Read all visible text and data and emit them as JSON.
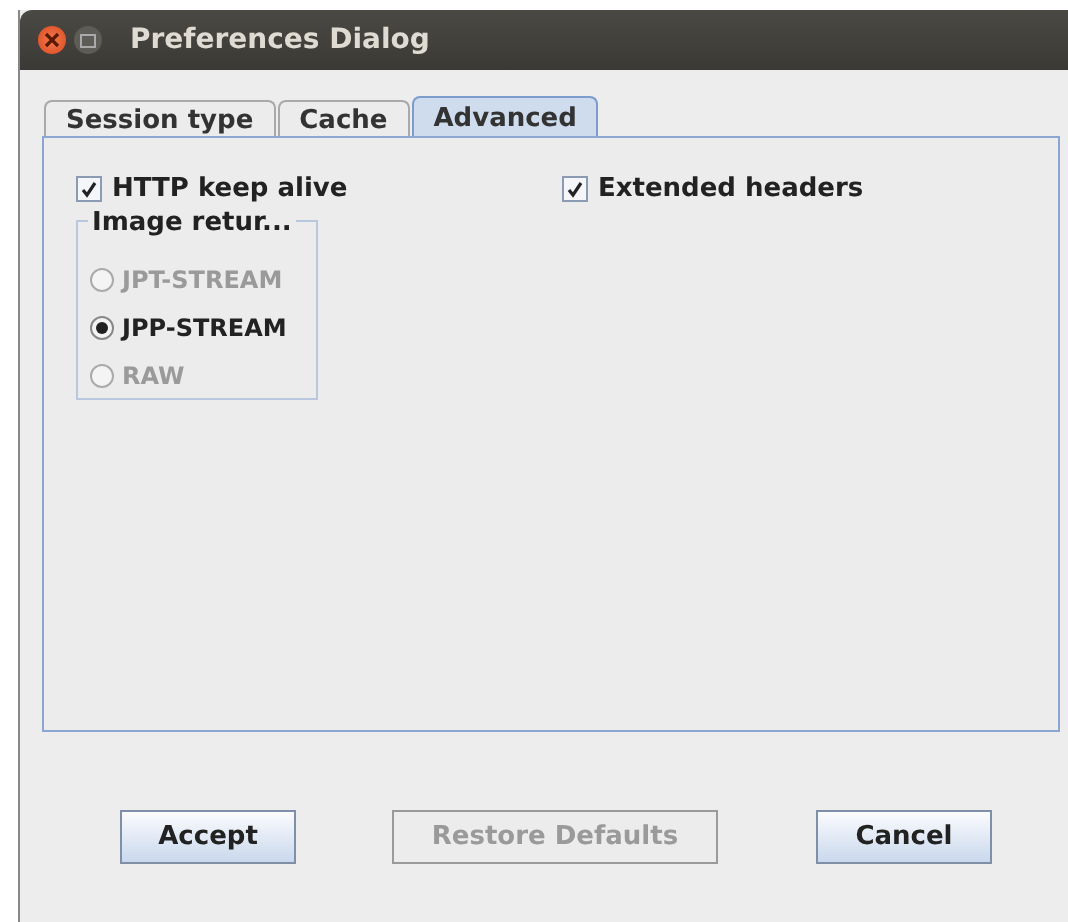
{
  "window": {
    "title": "Preferences Dialog"
  },
  "tabs": [
    {
      "label": "Session type",
      "selected": false
    },
    {
      "label": "Cache",
      "selected": false
    },
    {
      "label": "Advanced",
      "selected": true
    }
  ],
  "checkboxes": [
    {
      "label": "HTTP keep alive",
      "checked": true
    },
    {
      "label": "Extended headers",
      "checked": true
    }
  ],
  "image_return": {
    "label": "Image retur...",
    "options": [
      {
        "label": "JPT-STREAM",
        "selected": false,
        "disabled": true
      },
      {
        "label": "JPP-STREAM",
        "selected": true,
        "disabled": false
      },
      {
        "label": "RAW",
        "selected": false,
        "disabled": true
      }
    ]
  },
  "buttons": [
    {
      "label": "Accept",
      "disabled": false
    },
    {
      "label": "Restore Defaults",
      "disabled": true
    },
    {
      "label": "Cancel",
      "disabled": false
    }
  ]
}
